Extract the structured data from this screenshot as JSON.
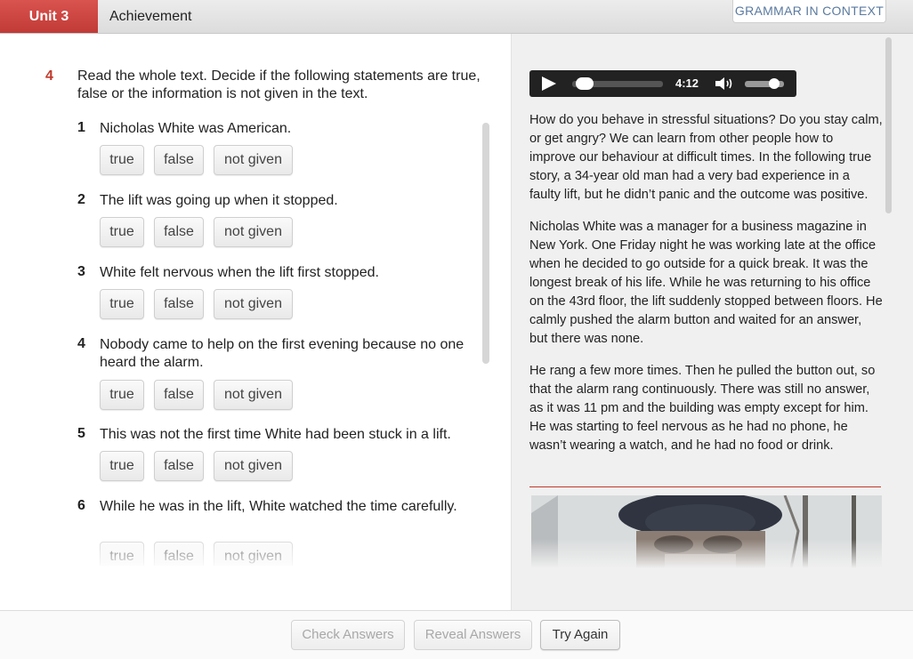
{
  "header": {
    "unit_label": "Unit 3",
    "title": "Achievement",
    "section_tab": "GRAMMAR IN CONTEXT"
  },
  "exercise": {
    "number": "4",
    "instruction": "Read the whole text. Decide if the following statements are true, false or the information is not given in the text.",
    "choice_labels": [
      "true",
      "false",
      "not given"
    ],
    "items": [
      {
        "num": "1",
        "text": "Nicholas White was American."
      },
      {
        "num": "2",
        "text": "The lift was going up when it stopped."
      },
      {
        "num": "3",
        "text": "White felt nervous when the lift first stopped."
      },
      {
        "num": "4",
        "text": "Nobody came to help on the first evening because no one heard the alarm."
      },
      {
        "num": "5",
        "text": "This was not the first time White had been stuck in a lift."
      },
      {
        "num": "6",
        "text": "While he was in the lift, White watched the time carefully."
      }
    ]
  },
  "player": {
    "time": "4:12",
    "progress_fraction": 0.05,
    "volume_fraction": 0.85,
    "play_icon": "play-icon",
    "speaker_icon": "speaker-icon"
  },
  "reading": {
    "paragraphs": [
      "How do you behave in stressful situations? Do you stay calm, or get angry? We can learn from other people how to improve our behaviour at difficult times. In the following true story, a 34-year old man had a very bad experience in a faulty lift, but he didn’t panic and the outcome was positive.",
      "Nicholas White was a manager for a business magazine in New York. One Friday night he was working late at the office when he decided to go outside for a quick break. It was the longest break of his life. While he was returning to his office on the 43rd floor, the lift suddenly stopped between floors. He calmly pushed the alarm button and waited for an answer, but there was none.",
      "He rang a few more times. Then he pulled the button out, so that the alarm rang continuously. There was still no answer, as it was 11 pm and the building was empty except for him. He was starting to feel nervous as he had no phone, he wasn’t wearing a watch, and he had no food or drink."
    ]
  },
  "footer": {
    "check_answers": "Check Answers",
    "reveal_answers": "Reveal Answers",
    "try_again": "Try Again"
  },
  "colors": {
    "accent_red": "#c13a36",
    "tab_blue_text": "#5a7aa0",
    "reading_bg": "#f0f0f0"
  }
}
